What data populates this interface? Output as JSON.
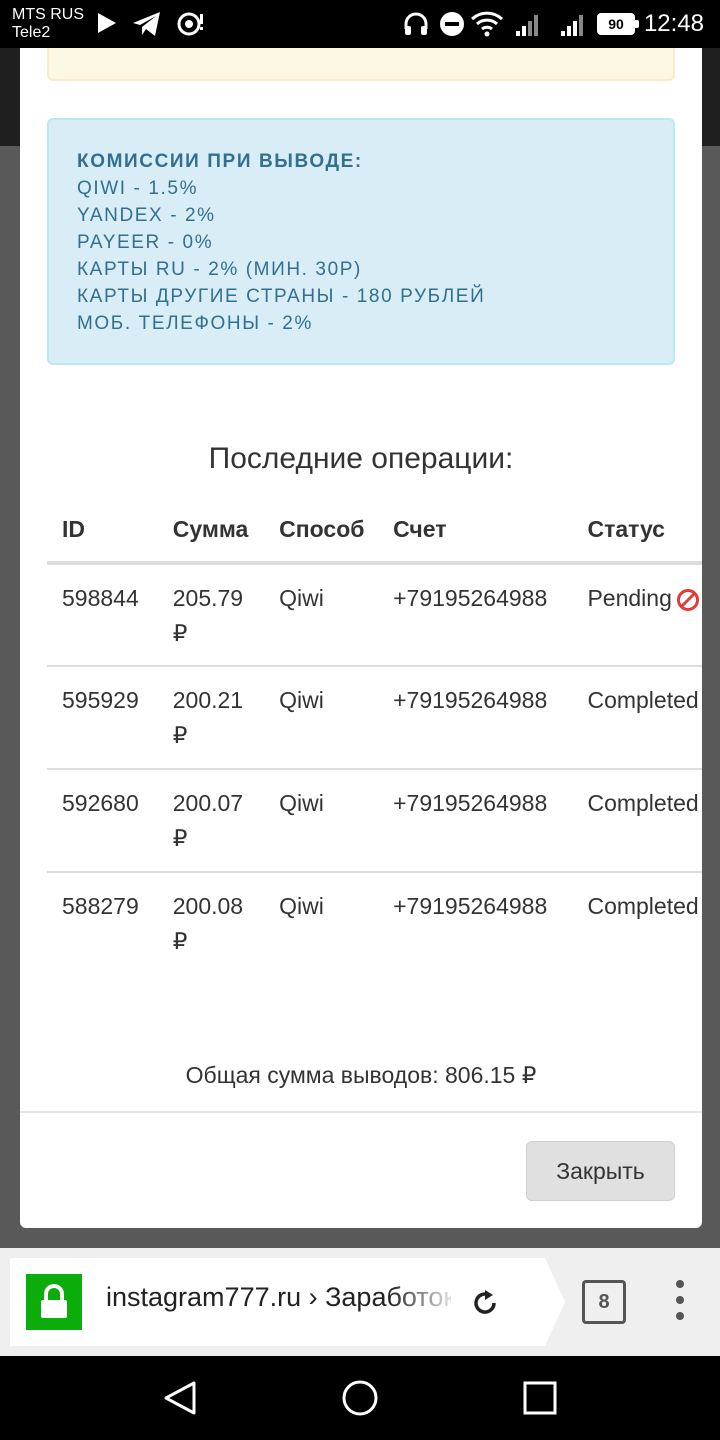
{
  "status_bar": {
    "carrier_1": "MTS RUS",
    "carrier_2": "Tele2",
    "battery": "90",
    "time": "12:48",
    "icons": [
      "play-icon",
      "telegram-icon",
      "radio-icon",
      "headphones-icon",
      "dnd-icon",
      "wifi-icon",
      "signal-icon",
      "signal-icon",
      "battery-icon"
    ]
  },
  "commissions": {
    "title": "КОМИССИИ ПРИ ВЫВОДЕ:",
    "lines": [
      "QIWI - 1.5%",
      "YANDEX - 2%",
      "PAYEER - 0%",
      "КАРТЫ RU - 2% (МИН. 30Р)",
      "КАРТЫ ДРУГИЕ СТРАНЫ - 180 РУБЛЕЙ",
      "МОБ. ТЕЛЕФОНЫ - 2%"
    ]
  },
  "operations": {
    "title": "Последние операции:",
    "headers": [
      "ID",
      "Сумма",
      "Способ",
      "Счет",
      "Статус"
    ],
    "rows": [
      {
        "id": "598844",
        "sum": "205.79",
        "currency": "₽",
        "method": "Qiwi",
        "account": "+79195264988",
        "status": "Pending"
      },
      {
        "id": "595929",
        "sum": "200.21",
        "currency": "₽",
        "method": "Qiwi",
        "account": "+79195264988",
        "status": "Completed"
      },
      {
        "id": "592680",
        "sum": "200.07",
        "currency": "₽",
        "method": "Qiwi",
        "account": "+79195264988",
        "status": "Completed"
      },
      {
        "id": "588279",
        "sum": "200.08",
        "currency": "₽",
        "method": "Qiwi",
        "account": "+79195264988",
        "status": "Completed"
      }
    ],
    "total": "Общая сумма выводов: 806.15 ₽"
  },
  "modal": {
    "close_label": "Закрыть"
  },
  "browser": {
    "url": "instagram777.ru › Заработок",
    "tab_count": "8"
  },
  "colors": {
    "info_bg": "#d9edf7",
    "info_text": "#31708f",
    "lock_green": "#0bad0b",
    "cancel_red": "#e53935"
  }
}
